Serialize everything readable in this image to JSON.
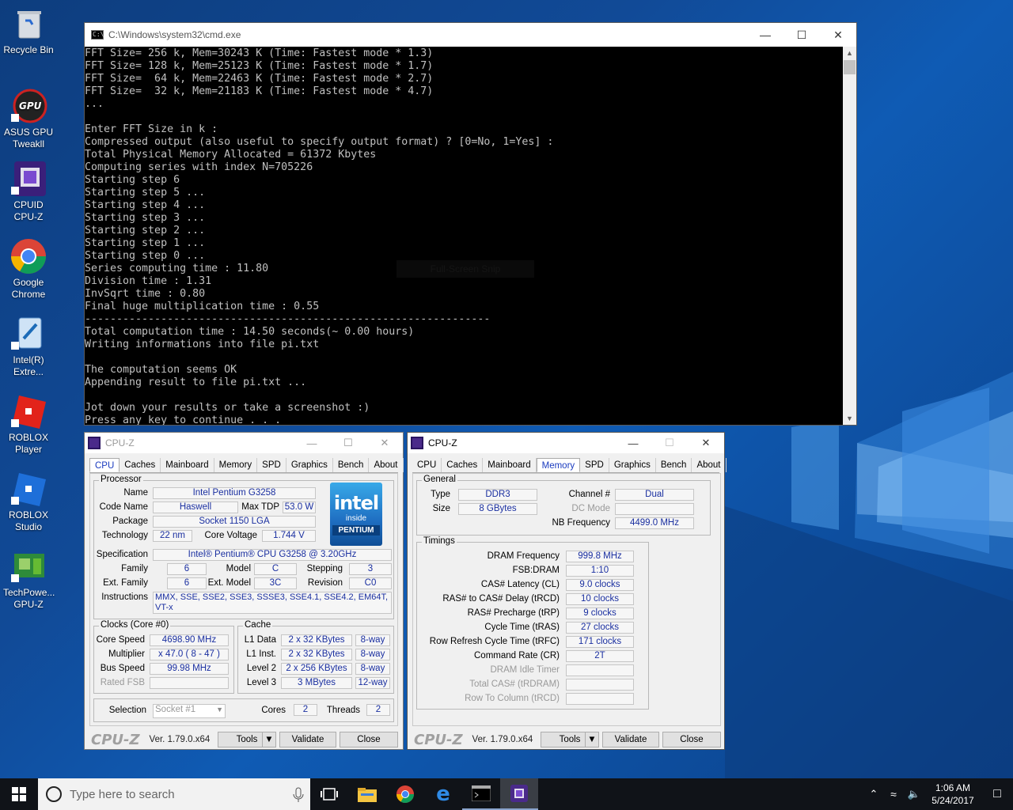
{
  "desktop": {
    "icons": [
      {
        "label": "Recycle Bin",
        "icon": "recycle-bin-icon"
      },
      {
        "label": "ASUS GPU Tweakll",
        "icon": "asus-gpu-tweak-icon"
      },
      {
        "label": "CPUID CPU-Z",
        "icon": "cpuz-icon"
      },
      {
        "label": "Google Chrome",
        "icon": "chrome-icon"
      },
      {
        "label": "Intel(R) Extre...",
        "icon": "intel-xtu-icon"
      },
      {
        "label": "ROBLOX Player",
        "icon": "roblox-player-icon"
      },
      {
        "label": "ROBLOX Studio",
        "icon": "roblox-studio-icon"
      },
      {
        "label": "TechPowe... GPU-Z",
        "icon": "gpuz-icon"
      }
    ]
  },
  "cmd": {
    "title": "C:\\Windows\\system32\\cmd.exe",
    "lines": [
      "FFT Size= 256 k, Mem=30243 K (Time: Fastest mode * 1.3)",
      "FFT Size= 128 k, Mem=25123 K (Time: Fastest mode * 1.7)",
      "FFT Size=  64 k, Mem=22463 K (Time: Fastest mode * 2.7)",
      "FFT Size=  32 k, Mem=21183 K (Time: Fastest mode * 4.7)",
      "...",
      "",
      "Enter FFT Size in k :",
      "Compressed output (also useful to specify output format) ? [0=No, 1=Yes] :",
      "Total Physical Memory Allocated = 61372 Kbytes",
      "Computing series with index N=705226",
      "Starting step 6",
      "Starting step 5 ...",
      "Starting step 4 ...",
      "Starting step 3 ...",
      "Starting step 2 ...",
      "Starting step 1 ...",
      "Starting step 0 ...",
      "Series computing time : 11.80",
      "Division time : 1.31",
      "InvSqrt time : 0.80",
      "Final huge multiplication time : 0.55",
      "----------------------------------------------------------------",
      "Total computation time : 14.50 seconds(~ 0.00 hours)",
      "Writing informations into file pi.txt",
      "",
      "The computation seems OK",
      "Appending result to file pi.txt ...",
      "",
      "Jot down your results or take a screenshot :)",
      "Press any key to continue . . ."
    ],
    "ghost_text": "Full-Screen Snip"
  },
  "cpuz_cpu": {
    "title": "CPU-Z",
    "tabs": [
      "CPU",
      "Caches",
      "Mainboard",
      "Memory",
      "SPD",
      "Graphics",
      "Bench",
      "About"
    ],
    "active_tab": "CPU",
    "processor": {
      "group": "Processor",
      "name_label": "Name",
      "name": "Intel Pentium G3258",
      "codename_label": "Code Name",
      "codename": "Haswell",
      "maxtdp_label": "Max TDP",
      "maxtdp": "53.0 W",
      "package_label": "Package",
      "package": "Socket 1150 LGA",
      "technology_label": "Technology",
      "technology": "22 nm",
      "corevoltage_label": "Core Voltage",
      "corevoltage": "1.744 V",
      "spec_label": "Specification",
      "spec": "Intel® Pentium® CPU G3258 @ 3.20GHz",
      "family_label": "Family",
      "family": "6",
      "model_label": "Model",
      "model": "C",
      "stepping_label": "Stepping",
      "stepping": "3",
      "extfamily_label": "Ext. Family",
      "extfamily": "6",
      "extmodel_label": "Ext. Model",
      "extmodel": "3C",
      "revision_label": "Revision",
      "revision": "C0",
      "instructions_label": "Instructions",
      "instructions": "MMX, SSE, SSE2, SSE3, SSSE3, SSE4.1, SSE4.2, EM64T, VT-x"
    },
    "logo": {
      "brand": "intel",
      "inside": "inside",
      "line": "PENTIUM"
    },
    "clocks": {
      "group": "Clocks (Core #0)",
      "corespeed_label": "Core Speed",
      "corespeed": "4698.90 MHz",
      "multiplier_label": "Multiplier",
      "multiplier": "x 47.0 ( 8 - 47 )",
      "busspeed_label": "Bus Speed",
      "busspeed": "99.98 MHz",
      "ratedfsb_label": "Rated FSB",
      "ratedfsb": ""
    },
    "cache": {
      "group": "Cache",
      "l1d_label": "L1 Data",
      "l1d": "2 x 32 KBytes",
      "l1d_way": "8-way",
      "l1i_label": "L1 Inst.",
      "l1i": "2 x 32 KBytes",
      "l1i_way": "8-way",
      "l2_label": "Level 2",
      "l2": "2 x 256 KBytes",
      "l2_way": "8-way",
      "l3_label": "Level 3",
      "l3": "3 MBytes",
      "l3_way": "12-way"
    },
    "selection_label": "Selection",
    "selection": "Socket #1",
    "cores_label": "Cores",
    "cores": "2",
    "threads_label": "Threads",
    "threads": "2",
    "brand": "CPU-Z",
    "version": "Ver. 1.79.0.x64",
    "tools": "Tools",
    "validate": "Validate",
    "close": "Close"
  },
  "cpuz_mem": {
    "title": "CPU-Z",
    "tabs": [
      "CPU",
      "Caches",
      "Mainboard",
      "Memory",
      "SPD",
      "Graphics",
      "Bench",
      "About"
    ],
    "active_tab": "Memory",
    "general": {
      "group": "General",
      "type_label": "Type",
      "type": "DDR3",
      "channel_label": "Channel #",
      "channel": "Dual",
      "size_label": "Size",
      "size": "8 GBytes",
      "dcmode_label": "DC Mode",
      "dcmode": "",
      "nbfreq_label": "NB Frequency",
      "nbfreq": "4499.0 MHz"
    },
    "timings": {
      "group": "Timings",
      "rows": [
        {
          "label": "DRAM Frequency",
          "value": "999.8 MHz",
          "dim": false
        },
        {
          "label": "FSB:DRAM",
          "value": "1:10",
          "dim": false
        },
        {
          "label": "CAS# Latency (CL)",
          "value": "9.0 clocks",
          "dim": false
        },
        {
          "label": "RAS# to CAS# Delay (tRCD)",
          "value": "10 clocks",
          "dim": false
        },
        {
          "label": "RAS# Precharge (tRP)",
          "value": "9 clocks",
          "dim": false
        },
        {
          "label": "Cycle Time (tRAS)",
          "value": "27 clocks",
          "dim": false
        },
        {
          "label": "Row Refresh Cycle Time (tRFC)",
          "value": "171 clocks",
          "dim": false
        },
        {
          "label": "Command Rate (CR)",
          "value": "2T",
          "dim": false
        },
        {
          "label": "DRAM Idle Timer",
          "value": "",
          "dim": true
        },
        {
          "label": "Total CAS# (tRDRAM)",
          "value": "",
          "dim": true
        },
        {
          "label": "Row To Column (tRCD)",
          "value": "",
          "dim": true
        }
      ]
    },
    "brand": "CPU-Z",
    "version": "Ver. 1.79.0.x64",
    "tools": "Tools",
    "validate": "Validate",
    "close": "Close"
  },
  "taskbar": {
    "search_placeholder": "Type here to search",
    "time": "1:06 AM",
    "date": "5/24/2017",
    "apps": [
      "task-view",
      "file-explorer",
      "chrome",
      "edge",
      "cmd",
      "cpuz"
    ],
    "active_app": "cpuz"
  },
  "colors": {
    "desktop": "#0f4e9e",
    "value_text": "#1a2fa0",
    "active_tab_text": "#1a3bbf"
  }
}
